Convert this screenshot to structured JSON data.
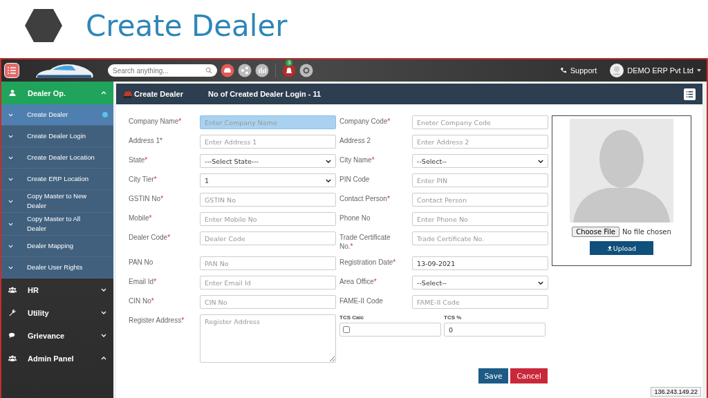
{
  "slide": {
    "title": "Create Dealer"
  },
  "topbar": {
    "search": {
      "placeholder": "Search anything..."
    },
    "notification_badge": "3",
    "support": "Support",
    "user": "DEMO ERP Pvt Ltd"
  },
  "sidebar": {
    "sections": [
      {
        "kind": "user",
        "label": "Dealer Op.",
        "expanded": true,
        "active": true,
        "children": [
          {
            "label": "Create Dealer",
            "selected": true
          },
          {
            "label": "Create Dealer Login",
            "selected": false
          },
          {
            "label": "Create Dealer Location",
            "selected": false
          },
          {
            "label": "Create ERP Location",
            "selected": false
          },
          {
            "label": "Copy Master to New Dealer",
            "selected": false
          },
          {
            "label": "Copy Master to All Dealer",
            "selected": false
          },
          {
            "label": "Dealer Mapping",
            "selected": false
          },
          {
            "label": "Dealer User Rights",
            "selected": false
          }
        ]
      },
      {
        "kind": "users",
        "label": "HR",
        "expanded": false,
        "active": false
      },
      {
        "kind": "wrench",
        "label": "Utility",
        "expanded": false,
        "active": false
      },
      {
        "kind": "chat",
        "label": "Grievance",
        "expanded": false,
        "active": false
      },
      {
        "kind": "users",
        "label": "Admin Panel",
        "expanded": true,
        "active": false
      }
    ]
  },
  "panel": {
    "title": "Create Dealer",
    "subtitle": "No of Created Dealer Login - 11"
  },
  "form": {
    "rows": [
      {
        "left": {
          "kind": "input",
          "label": "Company Name",
          "mark": "*",
          "placeholder": "Enter Company Name",
          "focused": true
        },
        "right": {
          "kind": "input",
          "label": "Company Code",
          "mark": "*",
          "placeholder": "Eneter Company Code",
          "focused": false
        }
      },
      {
        "left": {
          "kind": "input",
          "label": "Address 1*",
          "placeholder": "Enter Address 1",
          "focused": false
        },
        "right": {
          "kind": "input",
          "label": "Address 2",
          "placeholder": "Enter Address 2",
          "focused": false
        }
      },
      {
        "left": {
          "kind": "select",
          "label": "State",
          "mark": "*",
          "value": "---Select State---",
          "focused": false
        },
        "right": {
          "kind": "select",
          "label": "City Name",
          "mark": "*",
          "value": "--Select--",
          "focused": false
        }
      },
      {
        "left": {
          "kind": "select",
          "label": "City Tier",
          "mark": "*",
          "value": "1",
          "focused": false
        },
        "right": {
          "kind": "input",
          "label": "PIN Code",
          "placeholder": "Enter PIN",
          "focused": false
        }
      },
      {
        "left": {
          "kind": "input",
          "label": "GSTIN No",
          "mark": "*",
          "placeholder": "GSTIN No",
          "focused": false
        },
        "right": {
          "kind": "input",
          "label": "Contact Person",
          "mark": "*",
          "placeholder": "Contact Person",
          "focused": false
        }
      },
      {
        "left": {
          "kind": "input",
          "label": "Mobile",
          "mark": "*",
          "placeholder": "Enter Mobile No",
          "focused": false
        },
        "right": {
          "kind": "input",
          "label": "Phone No",
          "placeholder": "Enter Phone No",
          "focused": false
        }
      },
      {
        "left": {
          "kind": "input",
          "label": "Dealer Code",
          "mark": "*",
          "placeholder": "Dealer Code",
          "focused": false
        },
        "right": {
          "kind": "input",
          "label": "Trade Certificate No.",
          "mark": "*",
          "placeholder": "Trade Certificate No.",
          "focused": false
        }
      },
      {
        "left": {
          "kind": "input",
          "label": "PAN No",
          "placeholder": "PAN No",
          "focused": false
        },
        "right": {
          "kind": "input",
          "label": "Registration Date",
          "mark": "*",
          "value": "13-09-2021",
          "focused": false
        }
      },
      {
        "left": {
          "kind": "input",
          "label": "Email Id",
          "mark": "*",
          "placeholder": "Enter Email Id",
          "focused": false
        },
        "right": {
          "kind": "select",
          "label": "Area Office",
          "mark": "*",
          "value": "--Select--",
          "focused": false
        }
      },
      {
        "left": {
          "kind": "input",
          "label": "CIN No",
          "mark": "*",
          "placeholder": "CIN No",
          "focused": false
        },
        "right": {
          "kind": "input",
          "label": "FAME-II Code",
          "placeholder": "FAME-II Code",
          "focused": false
        }
      }
    ],
    "register": {
      "label": "Register Address",
      "mark": "*",
      "placeholder": "Register Address"
    },
    "tcs_calc": {
      "label": "TCS Calc",
      "checked": false
    },
    "tcs_percent": {
      "label": "TCS %",
      "value": "0"
    }
  },
  "photo": {
    "choose_button": "Choose File",
    "file_status": "No file chosen",
    "upload_button": "Upload"
  },
  "actions": {
    "save": "Save",
    "cancel": "Cancel"
  },
  "ip": "136.243.149.22"
}
